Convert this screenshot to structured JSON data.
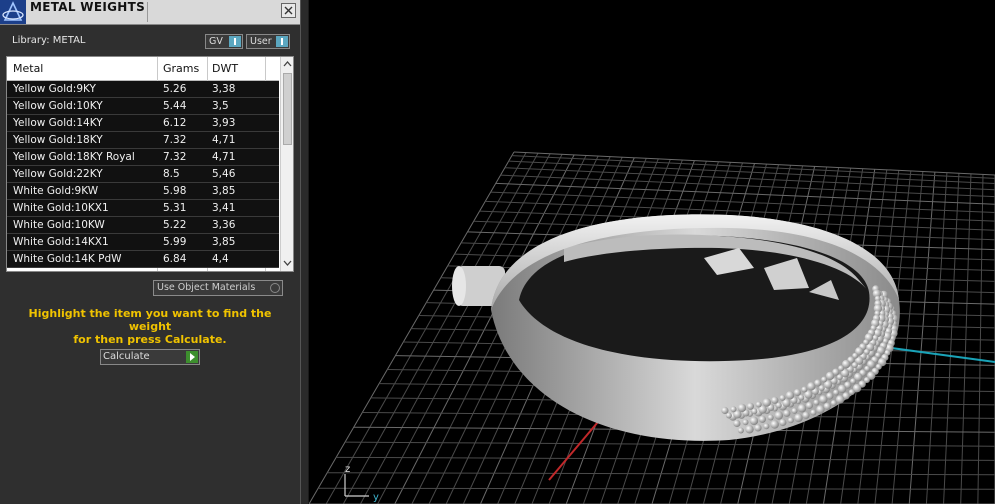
{
  "window": {
    "title": "METAL WEIGHTS"
  },
  "library": {
    "label": "Library: METAL",
    "gv_label": "GV",
    "user_label": "User"
  },
  "table": {
    "headers": [
      "Metal",
      "Grams",
      "DWT"
    ],
    "rows": [
      {
        "metal": "Yellow Gold:9KY",
        "grams": "5.26",
        "dwt": "3,38"
      },
      {
        "metal": "Yellow Gold:10KY",
        "grams": "5.44",
        "dwt": "3,5"
      },
      {
        "metal": "Yellow Gold:14KY",
        "grams": "6.12",
        "dwt": "3,93"
      },
      {
        "metal": "Yellow Gold:18KY",
        "grams": "7.32",
        "dwt": "4,71"
      },
      {
        "metal": "Yellow Gold:18KY Royal",
        "grams": "7.32",
        "dwt": "4,71"
      },
      {
        "metal": "Yellow Gold:22KY",
        "grams": "8.5",
        "dwt": "5,46"
      },
      {
        "metal": "White Gold:9KW",
        "grams": "5.98",
        "dwt": "3,85"
      },
      {
        "metal": "White Gold:10KX1",
        "grams": "5.31",
        "dwt": "3,41"
      },
      {
        "metal": "White Gold:10KW",
        "grams": "5.22",
        "dwt": "3,36"
      },
      {
        "metal": "White Gold:14KX1",
        "grams": "5.99",
        "dwt": "3,85"
      },
      {
        "metal": "White Gold:14K PdW",
        "grams": "6.84",
        "dwt": "4,4"
      }
    ]
  },
  "options": {
    "use_object_materials": "Use Object Materials"
  },
  "hint": {
    "line1": "Highlight the item you want to find the weight",
    "line2": "for then press Calculate."
  },
  "calculate": {
    "label": "Calculate"
  },
  "viewport": {
    "axis_z": "z",
    "axis_y": "y"
  },
  "colors": {
    "hint": "#f0c300",
    "accent_blue": "#5ba7c0",
    "go_green": "#3d8f2e",
    "axis_red": "#c0282a",
    "axis_cyan": "#1aa3b8"
  }
}
